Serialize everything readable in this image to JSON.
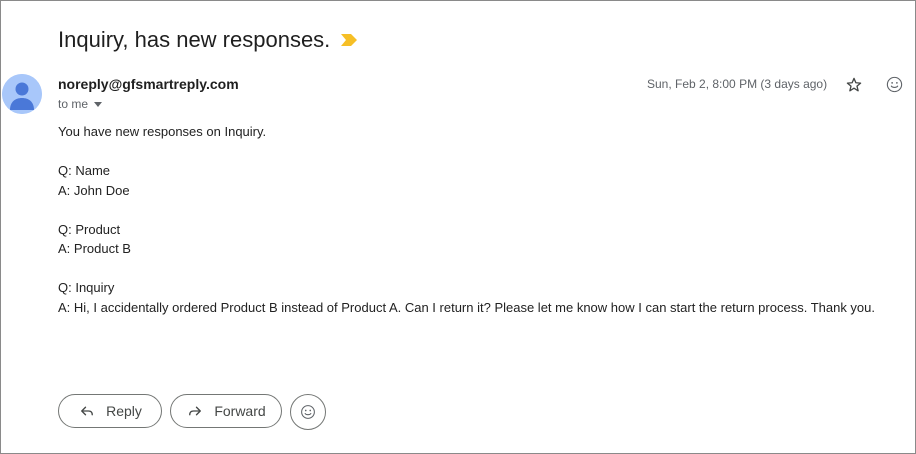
{
  "email": {
    "subject": "Inquiry, has new responses.",
    "sender": "noreply@gfsmartreply.com",
    "recipient_label": "to me",
    "date": "Sun, Feb 2, 8:00 PM (3 days ago)",
    "body": [
      "You have new responses on Inquiry.",
      "",
      "Q: Name",
      "A: John Doe",
      "",
      "Q: Product",
      "A: Product B",
      "",
      "Q: Inquiry",
      "A: Hi, I accidentally ordered Product B instead of Product A. Can I return it? Please let me know how I can start the return process. Thank you."
    ]
  },
  "actions": {
    "reply_label": "Reply",
    "forward_label": "Forward"
  },
  "icons": {
    "importance": "importance-marker-icon",
    "avatar": "person-avatar-icon",
    "star": "star-icon",
    "emoji": "emoji-icon",
    "reply": "reply-arrow-icon",
    "forward": "forward-arrow-icon",
    "caret": "chevron-down-icon"
  },
  "colors": {
    "importance_marker": "#f6bf26",
    "avatar_background": "#a8c7fa",
    "avatar_foreground": "#4a78d8"
  }
}
